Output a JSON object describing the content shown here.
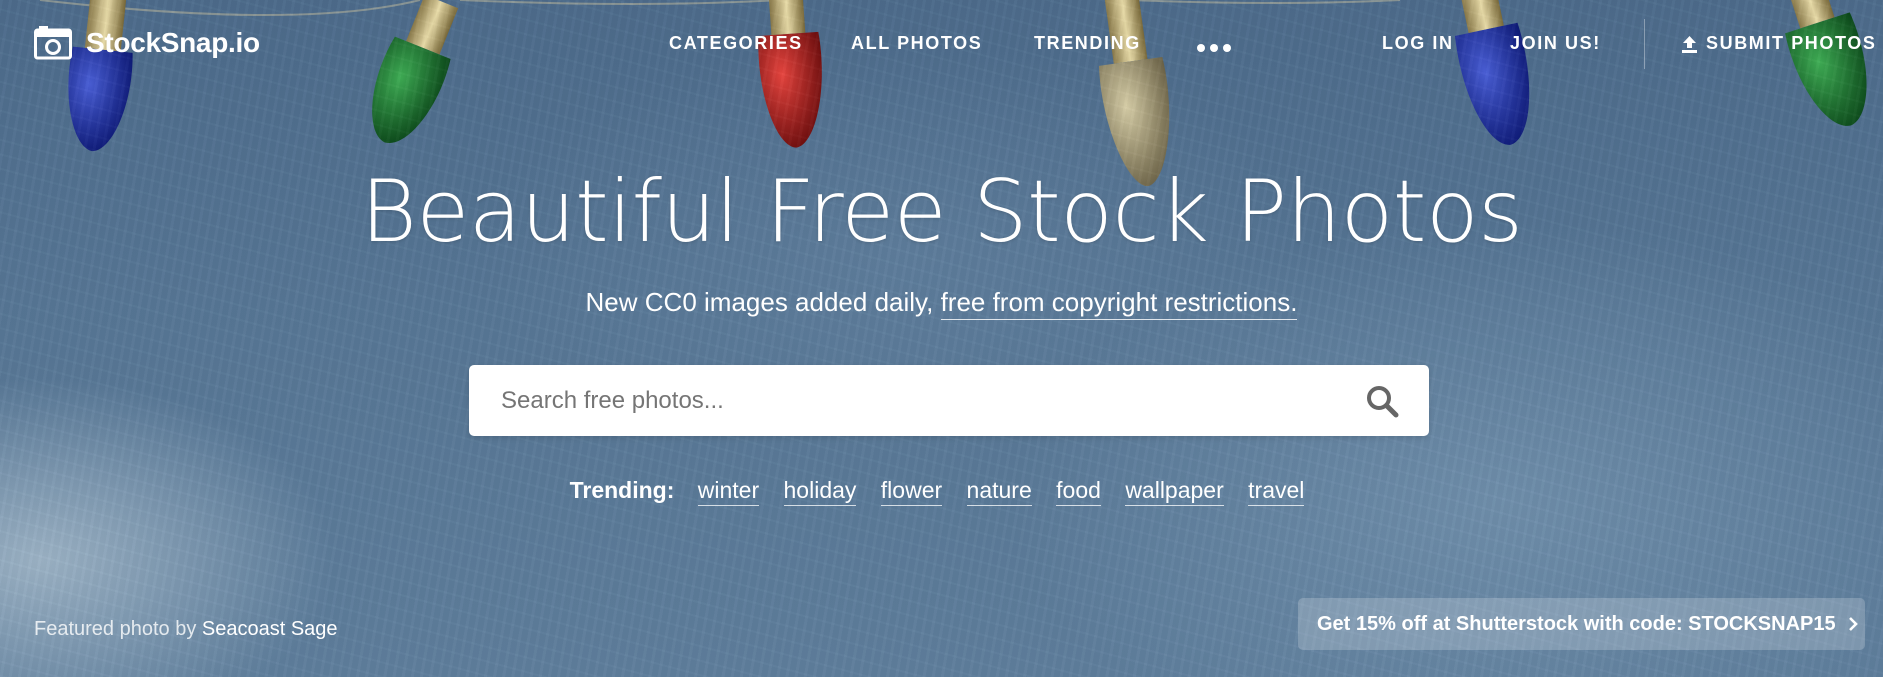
{
  "brand": {
    "name": "StockSnap.io",
    "icon": "camera-icon"
  },
  "nav": {
    "categories": "CATEGORIES",
    "all_photos": "ALL PHOTOS",
    "trending": "TRENDING",
    "more_icon": "more-dots-icon",
    "login": "LOG IN",
    "join": "JOIN US!",
    "submit": "SUBMIT PHOTOS",
    "submit_icon": "upload-icon"
  },
  "hero": {
    "headline": "Beautiful Free Stock Photos",
    "sub_prefix": "New CC0 images added daily, ",
    "sub_link": "free from copyright restrictions."
  },
  "search": {
    "placeholder": "Search free photos...",
    "icon": "search-icon"
  },
  "trending": {
    "label": "Trending:",
    "tags": [
      "winter",
      "holiday",
      "flower",
      "nature",
      "food",
      "wallpaper",
      "travel"
    ]
  },
  "footer": {
    "credit_prefix": "Featured photo by ",
    "credit_author": "Seacoast Sage",
    "promo": "Get 15% off at Shutterstock with code: STOCKSNAP15",
    "promo_icon": "chevron-right-icon"
  },
  "colors": {
    "background": "#587795",
    "text": "#ffffff",
    "search_bg": "#ffffff"
  }
}
